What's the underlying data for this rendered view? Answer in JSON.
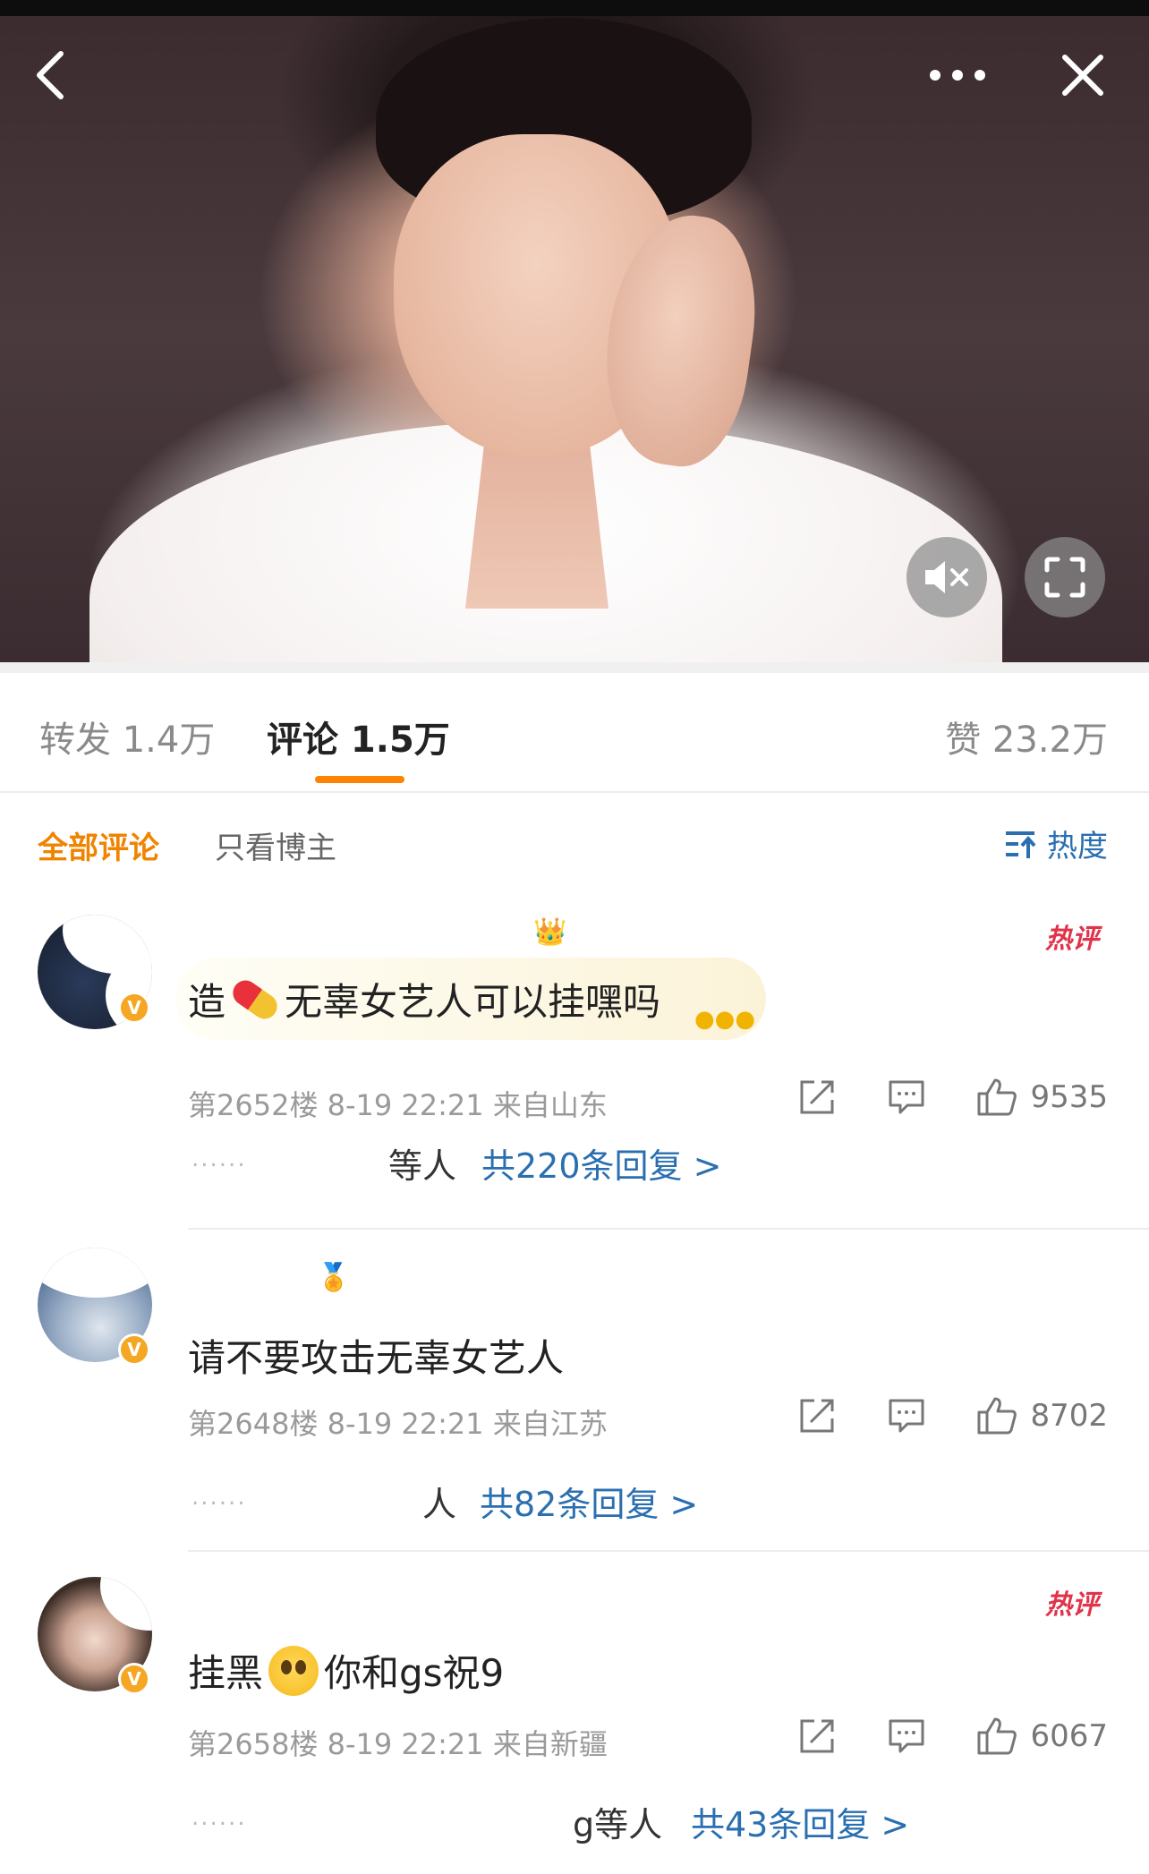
{
  "tabs": {
    "repost": "转发 1.4万",
    "comments": "评论 1.5万",
    "likes": "赞 23.2万"
  },
  "filters": {
    "all": "全部评论",
    "author_only": "只看博主",
    "sort": "热度"
  },
  "comments": [
    {
      "hot_tag": "热评",
      "text_pre": "造",
      "text_post": "无辜女艺人可以挂嘿吗",
      "floor": "第2652楼",
      "time": "8-19 22:21",
      "location": "来自山东",
      "likes": "9535",
      "reply_who": "等人",
      "reply_link": "共220条回复 >"
    },
    {
      "text": "请不要攻击无辜女艺人",
      "floor": "第2648楼",
      "time": "8-19 22:21",
      "location": "来自江苏",
      "likes": "8702",
      "reply_who": "人",
      "reply_link": "共82条回复 >"
    },
    {
      "hot_tag": "热评",
      "text_pre": "挂黑",
      "text_post": "你和gs祝9",
      "floor": "第2658楼",
      "time": "8-19 22:21",
      "location": "来自新疆",
      "likes": "6067",
      "reply_who": "g等人",
      "reply_link": "共43条回复 >"
    }
  ],
  "colors": {
    "accent": "#ff8200",
    "link": "#2a6fb0",
    "hot": "#e0344a",
    "verified": "#f5a623"
  },
  "icons": [
    "back-icon",
    "more-icon",
    "close-icon",
    "mute-icon",
    "fullscreen-icon",
    "sort-icon",
    "share-icon",
    "reply-icon",
    "like-icon"
  ]
}
